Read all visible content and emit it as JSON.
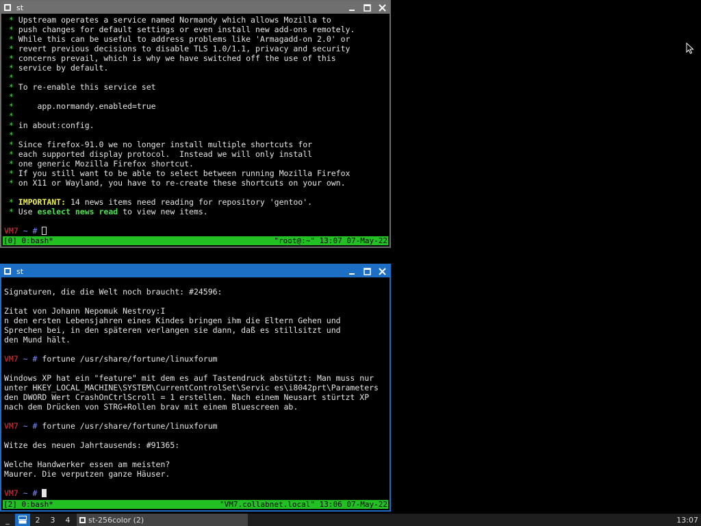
{
  "window_top": {
    "title": "st",
    "lines": [
      [
        {
          "t": " * ",
          "c": "g"
        },
        {
          "t": "Upstream operates a service named Normandy which allows Mozilla to"
        }
      ],
      [
        {
          "t": " * ",
          "c": "g"
        },
        {
          "t": "push changes for default settings or even install new add-ons remotely."
        }
      ],
      [
        {
          "t": " * ",
          "c": "g"
        },
        {
          "t": "While this can be useful to address problems like 'Armagadd-on 2.0' or"
        }
      ],
      [
        {
          "t": " * ",
          "c": "g"
        },
        {
          "t": "revert previous decisions to disable TLS 1.0/1.1, privacy and security"
        }
      ],
      [
        {
          "t": " * ",
          "c": "g"
        },
        {
          "t": "concerns prevail, which is why we have switched off the use of this"
        }
      ],
      [
        {
          "t": " * ",
          "c": "g"
        },
        {
          "t": "service by default."
        }
      ],
      [
        {
          "t": " *",
          "c": "g"
        }
      ],
      [
        {
          "t": " * ",
          "c": "g"
        },
        {
          "t": "To re-enable this service set"
        }
      ],
      [
        {
          "t": " *",
          "c": "g"
        }
      ],
      [
        {
          "t": " * ",
          "c": "g"
        },
        {
          "t": "    app.normandy.enabled=true"
        }
      ],
      [
        {
          "t": " *",
          "c": "g"
        }
      ],
      [
        {
          "t": " * ",
          "c": "g"
        },
        {
          "t": "in about:config."
        }
      ],
      [
        {
          "t": " *",
          "c": "g"
        }
      ],
      [
        {
          "t": " * ",
          "c": "g"
        },
        {
          "t": "Since firefox-91.0 we no longer install multiple shortcuts for"
        }
      ],
      [
        {
          "t": " * ",
          "c": "g"
        },
        {
          "t": "each supported display protocol.  Instead we will only install"
        }
      ],
      [
        {
          "t": " * ",
          "c": "g"
        },
        {
          "t": "one generic Mozilla Firefox shortcut."
        }
      ],
      [
        {
          "t": " * ",
          "c": "g"
        },
        {
          "t": "If you still want to be able to select between running Mozilla Firefox"
        }
      ],
      [
        {
          "t": " * ",
          "c": "g"
        },
        {
          "t": "on X11 or Wayland, you have to re-create these shortcuts on your own."
        }
      ],
      [],
      [
        {
          "t": " * ",
          "c": "g"
        },
        {
          "t": "IMPORTANT:",
          "c": "y"
        },
        {
          "t": " 14 news items need reading for repository 'gentoo'."
        }
      ],
      [
        {
          "t": " * ",
          "c": "g"
        },
        {
          "t": "Use "
        },
        {
          "t": "eselect news read",
          "c": "gb"
        },
        {
          "t": " to view new items."
        }
      ],
      [],
      [
        {
          "t": "VM7",
          "c": "r"
        },
        {
          "t": " ~ # ",
          "c": "b"
        },
        {
          "cursor": "hollow"
        }
      ]
    ],
    "status_left": "[0] 0:bash*",
    "status_right": "\"root@:~\" 13:07 07-May-22"
  },
  "window_bottom": {
    "title": "st",
    "lines": [
      [],
      [
        {
          "t": "Signaturen, die die Welt noch braucht: #24596:"
        }
      ],
      [],
      [
        {
          "t": "Zitat von Johann Nepomuk Nestroy:I"
        }
      ],
      [
        {
          "t": "n den ersten Lebensjahren eines Kindes bringen ihm die Eltern Gehen und"
        }
      ],
      [
        {
          "t": "Sprechen bei, in den späteren verlangen sie dann, daß es stillsitzt und"
        }
      ],
      [
        {
          "t": "den Mund hält."
        }
      ],
      [],
      [
        {
          "t": "VM7",
          "c": "r"
        },
        {
          "t": " ~ # ",
          "c": "b"
        },
        {
          "t": "fortune /usr/share/fortune/linuxforum"
        }
      ],
      [],
      [
        {
          "t": "Windows XP hat ein \"feature\" mit dem es auf Tastendruck abstützt: Man muss nur"
        }
      ],
      [
        {
          "t": "unter HKEY_LOCAL_MACHINE\\SYSTEM\\CurrentControlSet\\Servic es\\i8042prt\\Parameters"
        }
      ],
      [
        {
          "t": "den DWORD Wert CrashOnCtrlScroll = 1 erstellen. Nach einem Neusart stürtzt XP"
        }
      ],
      [
        {
          "t": "nach dem Drücken von STRG+Rollen brav mit einem Bluescreen ab."
        }
      ],
      [],
      [
        {
          "t": "VM7",
          "c": "r"
        },
        {
          "t": " ~ # ",
          "c": "b"
        },
        {
          "t": "fortune /usr/share/fortune/linuxforum"
        }
      ],
      [],
      [
        {
          "t": "Witze des neuen Jahrtausends: #91365:"
        }
      ],
      [],
      [
        {
          "t": "Welche Handwerker essen am meisten?"
        }
      ],
      [
        {
          "t": "Maurer. Die verputzen ganze Häuser."
        }
      ],
      [],
      [
        {
          "t": "VM7",
          "c": "r"
        },
        {
          "t": " ~ # ",
          "c": "b"
        },
        {
          "cursor": "solid"
        }
      ]
    ],
    "status_left": "[2] 0:bash*",
    "status_right": "\"VM7.collabnet.local\" 13:06 07-May-22"
  },
  "taskbar": {
    "workspaces": [
      "_",
      "",
      "2",
      "3",
      "4"
    ],
    "task_label": "st-256color (2)",
    "clock": "13:07"
  }
}
